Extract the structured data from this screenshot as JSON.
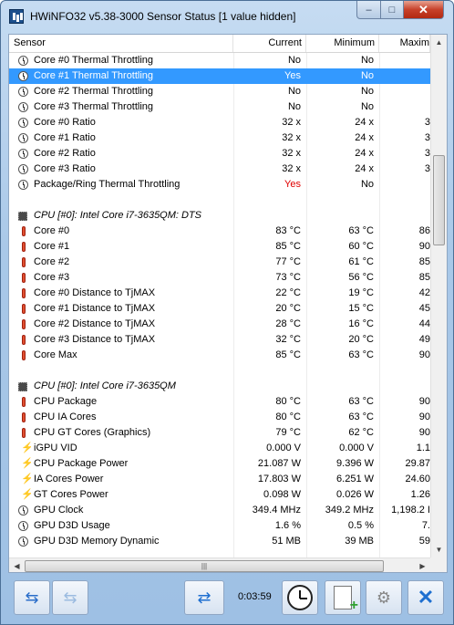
{
  "window": {
    "title": "HWiNFO32 v5.38-3000 Sensor Status [1 value hidden]",
    "controls": {
      "minimize": "–",
      "maximize": "□",
      "close": "✕"
    }
  },
  "columns": {
    "sensor": "Sensor",
    "current": "Current",
    "minimum": "Minimum",
    "maximum": "Maxim"
  },
  "rows": [
    {
      "icon": "clock-icon",
      "label": "Core #0 Thermal Throttling",
      "current": "No",
      "minimum": "No",
      "maximum": ""
    },
    {
      "icon": "clock-icon",
      "label": "Core #1 Thermal Throttling",
      "current": "Yes",
      "minimum": "No",
      "maximum": "",
      "selected": true
    },
    {
      "icon": "clock-icon",
      "label": "Core #2 Thermal Throttling",
      "current": "No",
      "minimum": "No",
      "maximum": ""
    },
    {
      "icon": "clock-icon",
      "label": "Core #3 Thermal Throttling",
      "current": "No",
      "minimum": "No",
      "maximum": ""
    },
    {
      "icon": "clock-icon",
      "label": "Core #0 Ratio",
      "current": "32 x",
      "minimum": "24 x",
      "maximum": "3"
    },
    {
      "icon": "clock-icon",
      "label": "Core #1 Ratio",
      "current": "32 x",
      "minimum": "24 x",
      "maximum": "3"
    },
    {
      "icon": "clock-icon",
      "label": "Core #2 Ratio",
      "current": "32 x",
      "minimum": "24 x",
      "maximum": "3"
    },
    {
      "icon": "clock-icon",
      "label": "Core #3 Ratio",
      "current": "32 x",
      "minimum": "24 x",
      "maximum": "3"
    },
    {
      "icon": "clock-icon",
      "label": "Package/Ring Thermal Throttling",
      "current": "Yes",
      "minimum": "No",
      "maximum": "",
      "red": true
    },
    {
      "blank": true
    },
    {
      "icon": "chip-icon",
      "label": "CPU [#0]: Intel Core i7-3635QM: DTS",
      "group": true
    },
    {
      "icon": "thermometer-icon",
      "label": "Core #0",
      "current": "83 °C",
      "minimum": "63 °C",
      "maximum": "86"
    },
    {
      "icon": "thermometer-icon",
      "label": "Core #1",
      "current": "85 °C",
      "minimum": "60 °C",
      "maximum": "90"
    },
    {
      "icon": "thermometer-icon",
      "label": "Core #2",
      "current": "77 °C",
      "minimum": "61 °C",
      "maximum": "85"
    },
    {
      "icon": "thermometer-icon",
      "label": "Core #3",
      "current": "73 °C",
      "minimum": "56 °C",
      "maximum": "85"
    },
    {
      "icon": "thermometer-icon",
      "label": "Core #0 Distance to TjMAX",
      "current": "22 °C",
      "minimum": "19 °C",
      "maximum": "42"
    },
    {
      "icon": "thermometer-icon",
      "label": "Core #1 Distance to TjMAX",
      "current": "20 °C",
      "minimum": "15 °C",
      "maximum": "45"
    },
    {
      "icon": "thermometer-icon",
      "label": "Core #2 Distance to TjMAX",
      "current": "28 °C",
      "minimum": "16 °C",
      "maximum": "44"
    },
    {
      "icon": "thermometer-icon",
      "label": "Core #3 Distance to TjMAX",
      "current": "32 °C",
      "minimum": "20 °C",
      "maximum": "49"
    },
    {
      "icon": "thermometer-icon",
      "label": "Core Max",
      "current": "85 °C",
      "minimum": "63 °C",
      "maximum": "90"
    },
    {
      "blank": true
    },
    {
      "icon": "chip-icon",
      "label": "CPU [#0]: Intel Core i7-3635QM",
      "group": true
    },
    {
      "icon": "thermometer-icon",
      "label": "CPU Package",
      "current": "80 °C",
      "minimum": "63 °C",
      "maximum": "90"
    },
    {
      "icon": "thermometer-icon",
      "label": "CPU IA Cores",
      "current": "80 °C",
      "minimum": "63 °C",
      "maximum": "90"
    },
    {
      "icon": "thermometer-icon",
      "label": "CPU GT Cores (Graphics)",
      "current": "79 °C",
      "minimum": "62 °C",
      "maximum": "90"
    },
    {
      "icon": "lightning-icon",
      "label": "iGPU VID",
      "current": "0.000 V",
      "minimum": "0.000 V",
      "maximum": "1.1"
    },
    {
      "icon": "lightning-icon",
      "label": "CPU Package Power",
      "current": "21.087 W",
      "minimum": "9.396 W",
      "maximum": "29.87"
    },
    {
      "icon": "lightning-icon",
      "label": "IA Cores Power",
      "current": "17.803 W",
      "minimum": "6.251 W",
      "maximum": "24.60"
    },
    {
      "icon": "lightning-icon",
      "label": "GT Cores Power",
      "current": "0.098 W",
      "minimum": "0.026 W",
      "maximum": "1.26"
    },
    {
      "icon": "clock-icon",
      "label": "GPU Clock",
      "current": "349.4 MHz",
      "minimum": "349.2 MHz",
      "maximum": "1,198.2 I"
    },
    {
      "icon": "clock-icon",
      "label": "GPU D3D Usage",
      "current": "1.6 %",
      "minimum": "0.5 %",
      "maximum": "7."
    },
    {
      "icon": "clock-icon",
      "label": "GPU D3D Memory Dynamic",
      "current": "51 MB",
      "minimum": "39 MB",
      "maximum": "59"
    }
  ],
  "scrollbars": {
    "up": "▲",
    "down": "▼",
    "left": "◀",
    "right": "▶",
    "grip": "|||"
  },
  "toolbar": {
    "elapsed": "0:03:59",
    "nav_forward_icon": "⇆",
    "nav_back_icon": "⇆",
    "network_icon": "⇄",
    "settings_icon": "⚙",
    "close_icon": "✕"
  }
}
